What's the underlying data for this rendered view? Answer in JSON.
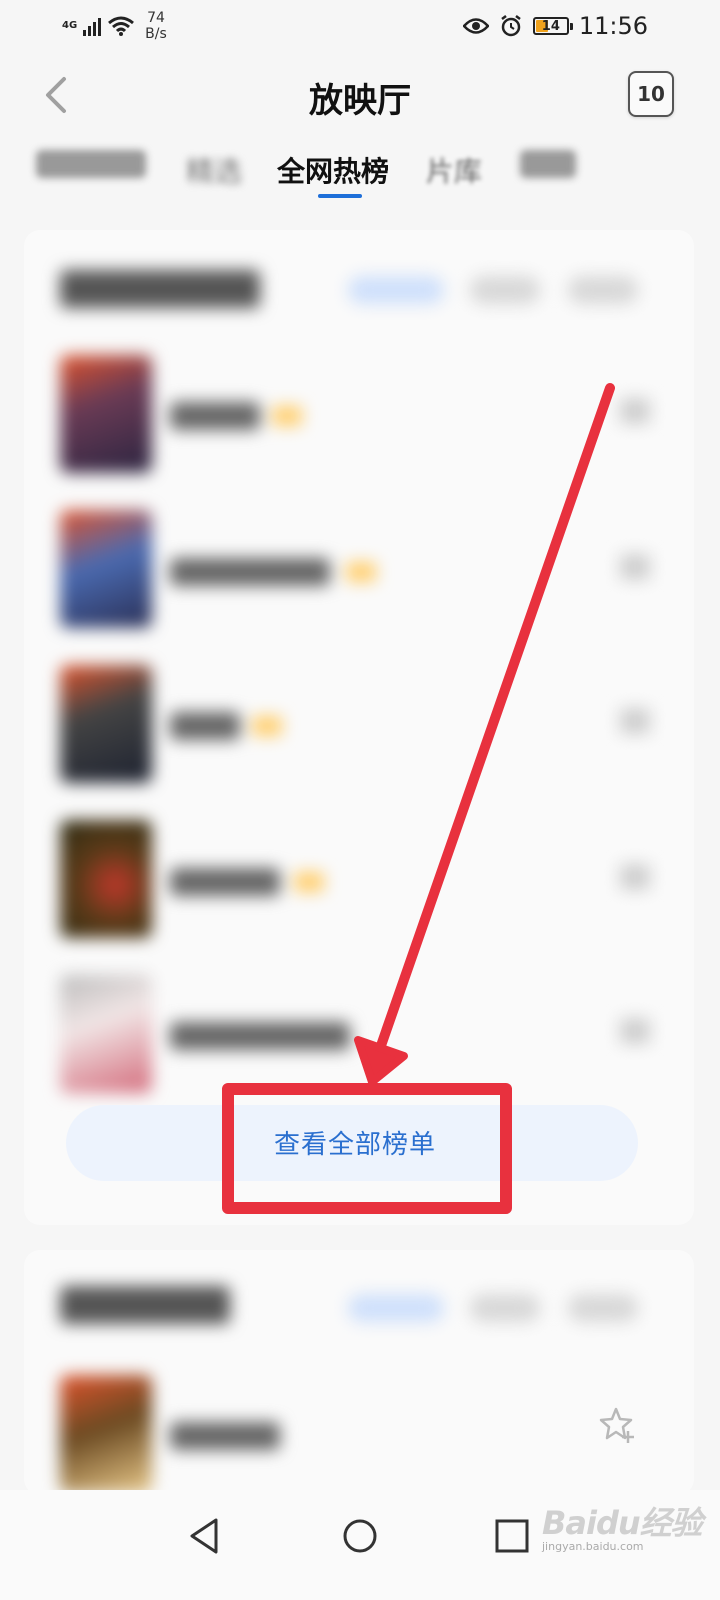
{
  "status_bar": {
    "network_type": "4G",
    "speed_value": "74",
    "speed_unit": "B/s",
    "battery_level": "14",
    "time": "11:56",
    "icons": [
      "signal-icon",
      "wifi-icon",
      "eye-icon",
      "alarm-icon",
      "battery-icon"
    ]
  },
  "header": {
    "title": "放映厅",
    "count_badge": "10"
  },
  "tabs": [
    {
      "label": "",
      "state": "blurred"
    },
    {
      "label": "精选",
      "state": "blurred"
    },
    {
      "label": "全网热榜",
      "state": "active"
    },
    {
      "label": "片库",
      "state": "normal"
    },
    {
      "label": "",
      "state": "blurred"
    }
  ],
  "ranking_card": {
    "view_all_label": "查看全部榜单"
  },
  "annotation": {
    "highlight_color": "#e8313e",
    "arrow_color": "#e8313e"
  },
  "colors": {
    "accent": "#1e6fd9",
    "link": "#2a6fcf",
    "button_bg": "#edf3fd"
  },
  "watermark": {
    "text": "Baidu经验",
    "sub": "jingyan.baidu.com"
  }
}
